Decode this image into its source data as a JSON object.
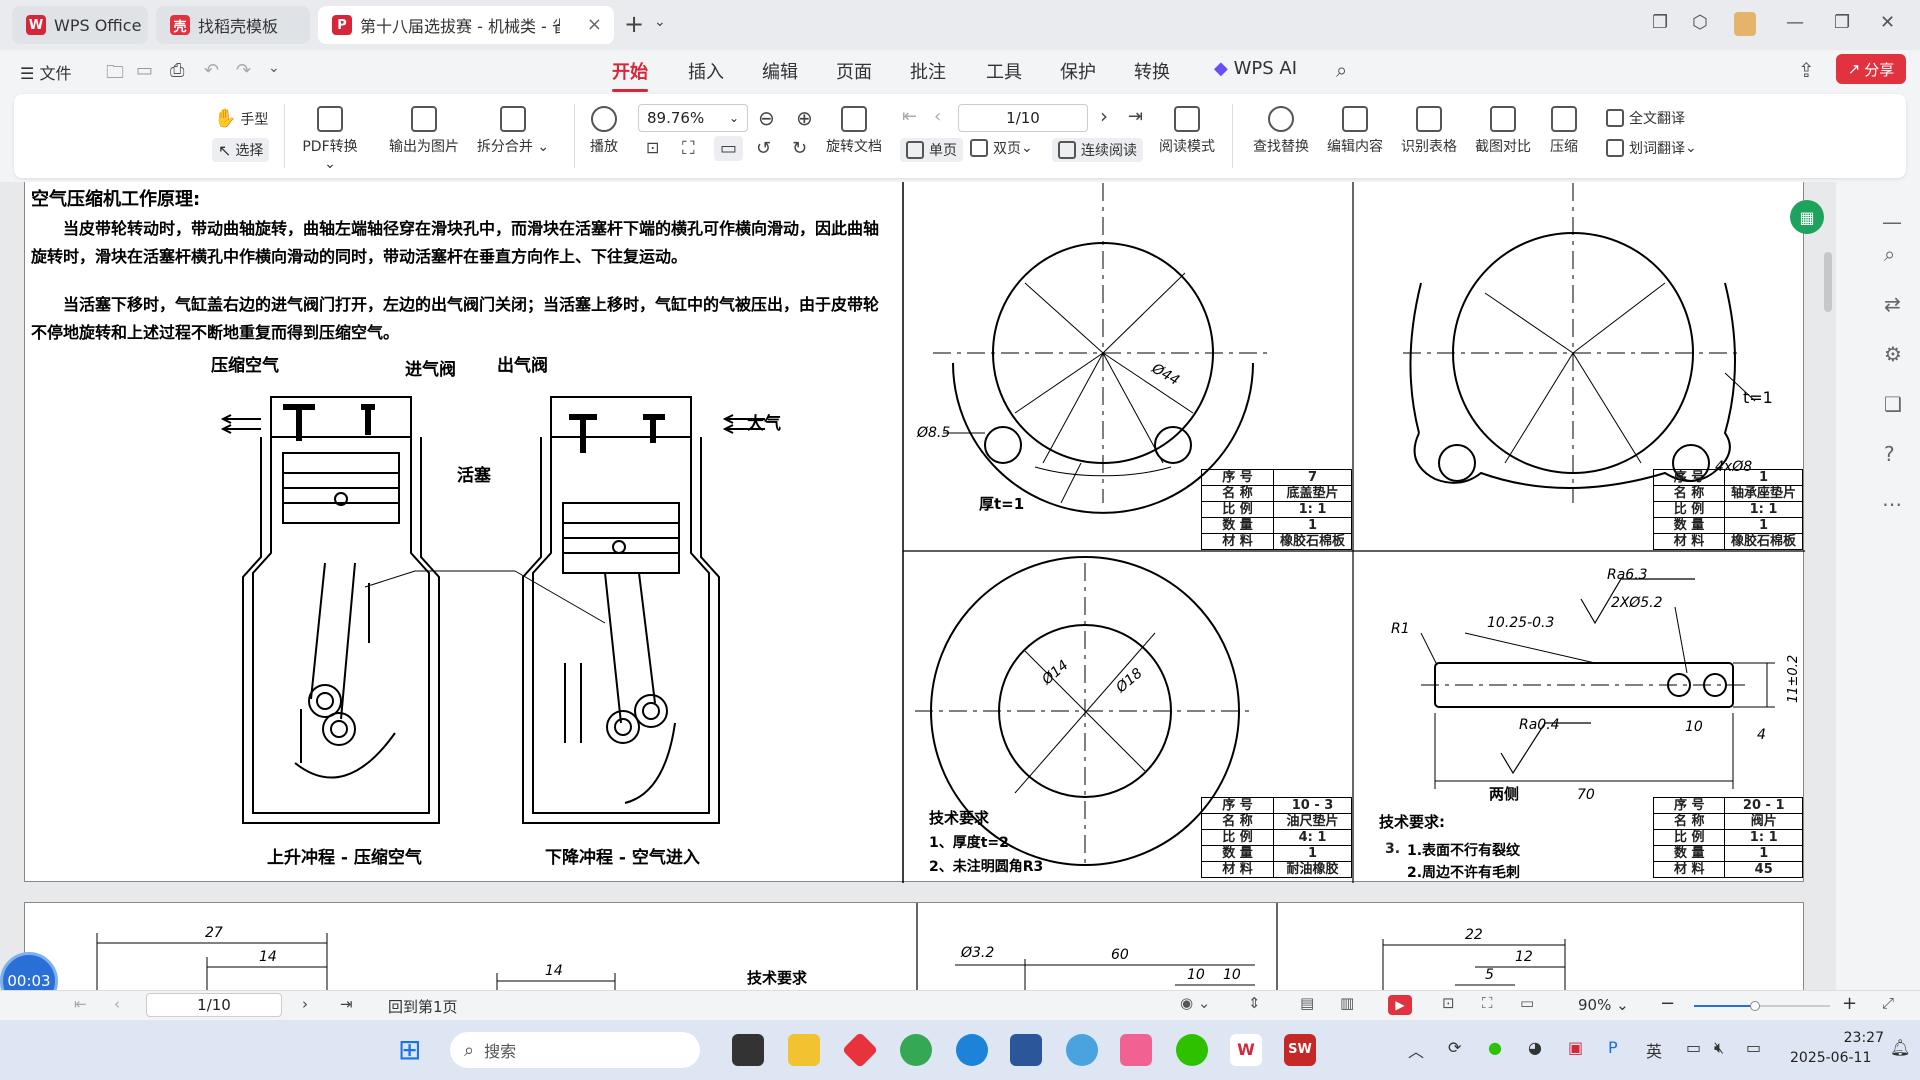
{
  "tabs": [
    {
      "label": "WPS Office",
      "color": "#d6263a"
    },
    {
      "label": "找稻壳模板",
      "color": "#e0323f"
    },
    {
      "label": "第十八届选拔赛 - 机械类 - 省",
      "color": "#d6263a"
    }
  ],
  "menu": {
    "file": "文件",
    "items": [
      "开始",
      "插入",
      "编辑",
      "页面",
      "批注",
      "工具",
      "保护",
      "转换"
    ],
    "active": "开始",
    "wps_ai": "WPS AI",
    "share": "分享"
  },
  "ribbon": {
    "hand": "手型",
    "select": "选择",
    "pdf_convert": "PDF转换",
    "export_image": "输出为图片",
    "split_merge": "拆分合并",
    "play": "播放",
    "zoom": "89.76%",
    "page": "1/10",
    "rotate": "旋转文档",
    "single": "单页",
    "double": "双页",
    "continuous": "连续阅读",
    "read_mode": "阅读模式",
    "find_replace": "查找替换",
    "edit_content": "编辑内容",
    "recognize_table": "识别表格",
    "screenshot_compare": "截图对比",
    "compress": "压缩",
    "full_translate": "全文翻译",
    "word_translate": "划词翻译"
  },
  "doc": {
    "heading": "空气压缩机工作原理:",
    "para1": "当皮带轮转动时，带动曲轴旋转，曲轴左端轴径穿在滑块孔中，而滑块在活塞杆下端的横孔可作横向滑动，因此曲轴旋转时，滑块在活塞杆横孔中作横向滑动的同时，带动活塞杆在垂直方向作上、下往复运动。",
    "para2": "当活塞下移时，气缸盖右边的进气阀门打开，左边的出气阀门关闭；当活塞上移时，气缸中的气被压出，由于皮带轮不停地旋转和上述过程不断地重复而得到压缩空气。",
    "label_compressed_air": "压缩空气",
    "label_intake_valve": "进气阀",
    "label_outlet_valve": "出气阀",
    "label_atmosphere": "大气",
    "label_piston": "活塞",
    "caption_up": "上升冲程 - 压缩空气",
    "caption_down": "下降冲程 - 空气进入"
  },
  "drawings": {
    "d1": {
      "dim_d44": "Ø44",
      "dim_d85": "Ø8.5",
      "thickness": "厚t=1",
      "table": [
        [
          "序 号",
          "7"
        ],
        [
          "名 称",
          "底盖垫片"
        ],
        [
          "比 例",
          "1: 1"
        ],
        [
          "数 量",
          "1"
        ],
        [
          "材 料",
          "橡胶石棉板"
        ]
      ]
    },
    "d2": {
      "thickness": "t=1",
      "dim_holes": "4xØ8",
      "table": [
        [
          "序 号",
          "1"
        ],
        [
          "名 称",
          "轴承座垫片"
        ],
        [
          "比 例",
          "1: 1"
        ],
        [
          "数 量",
          "1"
        ],
        [
          "材 料",
          "橡胶石棉板"
        ]
      ]
    },
    "d3": {
      "dim_d14": "Ø14",
      "dim_d18": "Ø18",
      "tech_title": "技术要求",
      "tech1": "1、厚度t=2",
      "tech2": "2、未注明圆角R3",
      "table": [
        [
          "序 号",
          "10 - 3"
        ],
        [
          "名 称",
          "油尺垫片"
        ],
        [
          "比 例",
          "4: 1"
        ],
        [
          "数 量",
          "1"
        ],
        [
          "材 料",
          "耐油橡胶"
        ]
      ]
    },
    "d4": {
      "ra63": "Ra6.3",
      "holes": "2XØ5.2",
      "r1": "R1",
      "tol": "10.25-0.3",
      "ra04": "Ra0.4",
      "both_sides": "两侧",
      "len70": "70",
      "dim10": "10",
      "dim4": "4",
      "dim_h": "11±0.2",
      "tech_title": "技术要求:",
      "tech1": "1.表面不行有裂纹",
      "tech2": "2.周边不许有毛刺",
      "tech3": "3.",
      "table": [
        [
          "序 号",
          "20 - 1"
        ],
        [
          "名 称",
          "阀片"
        ],
        [
          "比 例",
          "1: 1"
        ],
        [
          "数 量",
          "1"
        ],
        [
          "材 料",
          "45"
        ]
      ]
    },
    "p2": {
      "d27": "27",
      "d14a": "14",
      "d14b": "14",
      "tech": "技术要求",
      "d32": "Ø3.2",
      "d60": "60",
      "d10a": "10",
      "d10b": "10",
      "d22": "22",
      "d12": "12",
      "d5": "5"
    }
  },
  "status": {
    "page": "1/10",
    "back_first": "回到第1页",
    "zoom": "90%",
    "timer": "00:03"
  },
  "taskbar": {
    "search": "搜索",
    "lang": "英",
    "time": "23:27",
    "date": "2025-06-11"
  }
}
